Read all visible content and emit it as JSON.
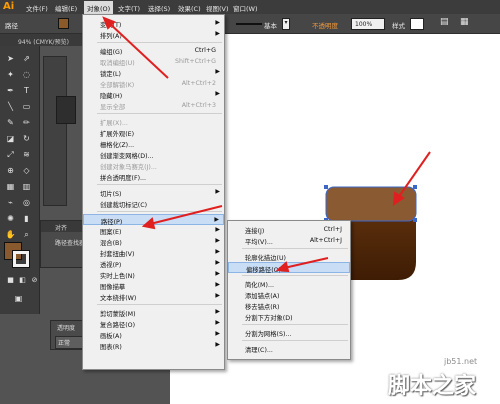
{
  "app": {
    "logo": "Ai",
    "menu": [
      "文件(F)",
      "编辑(E)",
      "对象(O)",
      "文字(T)",
      "选择(S)",
      "效果(C)",
      "视图(V)",
      "窗口(W)"
    ],
    "active_menu": "对象(O)"
  },
  "controlbar": {
    "mode_label": "路径",
    "stroke_style": "基本",
    "opacity_label": "不透明度",
    "opacity_value": "100%",
    "style_label": "样式"
  },
  "document": {
    "tab": "94% (CMYK/预览)"
  },
  "colors": {
    "fill": "#8b5a2b",
    "shape_top": "#8a5a33",
    "shape_bottom": "#4a2408",
    "menu_bg": "#f0f0f0",
    "highlight": "#c9ddf5",
    "arrow": "#e02020"
  },
  "panels": {
    "align": {
      "tabs": [
        "对齐",
        "路径查找器"
      ]
    },
    "transparency": {
      "tab": "透明度",
      "blend": "正常"
    }
  },
  "object_menu": {
    "items": [
      {
        "label": "变换(T)",
        "shortcut": "",
        "submenu": true,
        "disabled": false
      },
      {
        "label": "排列(A)",
        "shortcut": "",
        "submenu": true,
        "disabled": false
      },
      {
        "label": "编组(G)",
        "shortcut": "Ctrl+G",
        "submenu": false,
        "disabled": false
      },
      {
        "label": "取消编组(U)",
        "shortcut": "Shift+Ctrl+G",
        "submenu": false,
        "disabled": true
      },
      {
        "label": "锁定(L)",
        "shortcut": "",
        "submenu": true,
        "disabled": false
      },
      {
        "label": "全部解锁(K)",
        "shortcut": "Alt+Ctrl+2",
        "submenu": false,
        "disabled": true
      },
      {
        "label": "隐藏(H)",
        "shortcut": "",
        "submenu": true,
        "disabled": false
      },
      {
        "label": "显示全部",
        "shortcut": "Alt+Ctrl+3",
        "submenu": false,
        "disabled": true
      },
      {
        "label": "扩展(X)...",
        "shortcut": "",
        "submenu": false,
        "disabled": true
      },
      {
        "label": "扩展外观(E)",
        "shortcut": "",
        "submenu": false,
        "disabled": false
      },
      {
        "label": "栅格化(Z)...",
        "shortcut": "",
        "submenu": false,
        "disabled": false
      },
      {
        "label": "创建渐变网格(D)...",
        "shortcut": "",
        "submenu": false,
        "disabled": false
      },
      {
        "label": "创建对象马赛克(J)...",
        "shortcut": "",
        "submenu": false,
        "disabled": true
      },
      {
        "label": "拼合透明度(F)...",
        "shortcut": "",
        "submenu": false,
        "disabled": false
      },
      {
        "label": "切片(S)",
        "shortcut": "",
        "submenu": true,
        "disabled": false
      },
      {
        "label": "创建裁切标记(C)",
        "shortcut": "",
        "submenu": false,
        "disabled": false
      },
      {
        "label": "路径(P)",
        "shortcut": "",
        "submenu": true,
        "disabled": false
      },
      {
        "label": "图案(E)",
        "shortcut": "",
        "submenu": true,
        "disabled": false
      },
      {
        "label": "混合(B)",
        "shortcut": "",
        "submenu": true,
        "disabled": false
      },
      {
        "label": "封套扭曲(V)",
        "shortcut": "",
        "submenu": true,
        "disabled": false
      },
      {
        "label": "透视(P)",
        "shortcut": "",
        "submenu": true,
        "disabled": false
      },
      {
        "label": "实时上色(N)",
        "shortcut": "",
        "submenu": true,
        "disabled": false
      },
      {
        "label": "图像描摹",
        "shortcut": "",
        "submenu": true,
        "disabled": false
      },
      {
        "label": "文本绕排(W)",
        "shortcut": "",
        "submenu": true,
        "disabled": false
      },
      {
        "label": "剪切蒙版(M)",
        "shortcut": "",
        "submenu": true,
        "disabled": false
      },
      {
        "label": "复合路径(O)",
        "shortcut": "",
        "submenu": true,
        "disabled": false
      },
      {
        "label": "画板(A)",
        "shortcut": "",
        "submenu": true,
        "disabled": false
      },
      {
        "label": "图表(R)",
        "shortcut": "",
        "submenu": true,
        "disabled": false
      }
    ]
  },
  "path_submenu": {
    "items": [
      {
        "label": "连接(J)",
        "shortcut": "Ctrl+J",
        "disabled": false
      },
      {
        "label": "平均(V)...",
        "shortcut": "Alt+Ctrl+J",
        "disabled": false
      },
      {
        "label": "轮廓化描边(U)",
        "shortcut": "",
        "disabled": false
      },
      {
        "label": "偏移路径(O)...",
        "shortcut": "",
        "disabled": false
      },
      {
        "label": "简化(M)...",
        "shortcut": "",
        "disabled": false
      },
      {
        "label": "添加锚点(A)",
        "shortcut": "",
        "disabled": false
      },
      {
        "label": "移去锚点(R)",
        "shortcut": "",
        "disabled": false
      },
      {
        "label": "分割下方对象(D)",
        "shortcut": "",
        "disabled": false
      },
      {
        "label": "分割为网格(S)...",
        "shortcut": "",
        "disabled": false
      },
      {
        "label": "清理(C)...",
        "shortcut": "",
        "disabled": false
      }
    ]
  },
  "watermark": {
    "site": "jb51.net",
    "brand": "脚本之家"
  }
}
